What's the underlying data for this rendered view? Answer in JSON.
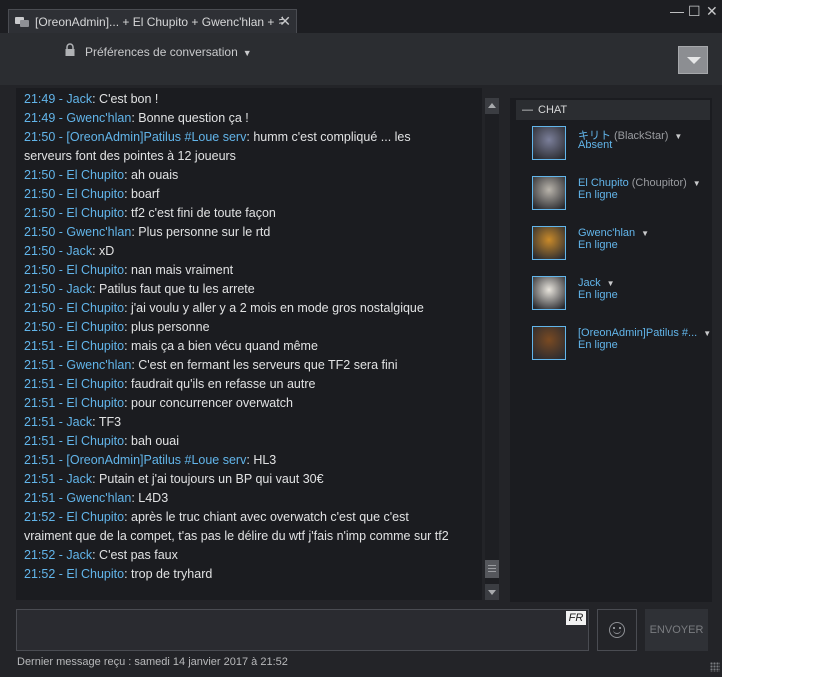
{
  "window": {
    "tab_title": "[OreonAdmin]... + El Chupito + Gwenc'hlan + キ...",
    "tab_close": "✕",
    "minimize": "—",
    "maximize": "☐",
    "close": "✕"
  },
  "toolbar": {
    "prefs_label": "Préférences de conversation",
    "caret": "▼"
  },
  "messages": [
    {
      "who": "21:49 - Jack",
      "text": "C'est bon !"
    },
    {
      "who": "21:49 - Gwenc'hlan",
      "text": "Bonne question ça !"
    },
    {
      "who": "21:50 - [OreonAdmin]Patilus #Loue serv",
      "text": "humm c'est compliqué ... les"
    },
    {
      "who": "",
      "text": "serveurs font des pointes à 12 joueurs"
    },
    {
      "who": "21:50 - El Chupito",
      "text": "ah ouais"
    },
    {
      "who": "21:50 - El Chupito",
      "text": "boarf"
    },
    {
      "who": "21:50 - El Chupito",
      "text": "tf2 c'est fini de toute façon"
    },
    {
      "who": "21:50 - Gwenc'hlan",
      "text": "Plus personne sur le rtd"
    },
    {
      "who": "21:50 - Jack",
      "text": "xD"
    },
    {
      "who": "21:50 - El Chupito",
      "text": "nan mais vraiment"
    },
    {
      "who": "21:50 - Jack",
      "text": "Patilus faut que tu les arrete"
    },
    {
      "who": "21:50 - El Chupito",
      "text": "j'ai voulu y aller y a 2 mois en mode gros nostalgique"
    },
    {
      "who": "21:50 - El Chupito",
      "text": "plus personne"
    },
    {
      "who": "21:51 - El Chupito",
      "text": "mais ça a bien vécu quand même"
    },
    {
      "who": "21:51 - Gwenc'hlan",
      "text": "C'est en fermant les serveurs que TF2 sera fini"
    },
    {
      "who": "21:51 - El Chupito",
      "text": "faudrait qu'ils en refasse un autre"
    },
    {
      "who": "21:51 - El Chupito",
      "text": "pour concurrencer overwatch"
    },
    {
      "who": "21:51 - Jack",
      "text": "TF3"
    },
    {
      "who": "21:51 - El Chupito",
      "text": "bah ouai"
    },
    {
      "who": "21:51 - [OreonAdmin]Patilus #Loue serv",
      "text": "HL3"
    },
    {
      "who": "21:51 - Jack",
      "text": "Putain et j'ai toujours un BP qui vaut 30€"
    },
    {
      "who": "21:51 - Gwenc'hlan",
      "text": "L4D3"
    },
    {
      "who": "21:52 - El Chupito",
      "text": "après le truc chiant avec overwatch c'est que c'est"
    },
    {
      "who": "",
      "text": "vraiment que de la compet, t'as pas le délire du wtf j'fais n'imp comme sur tf2"
    },
    {
      "who": "21:52 - Jack",
      "text": "C'est pas faux"
    },
    {
      "who": "21:52 - El Chupito",
      "text": "trop de tryhard"
    }
  ],
  "sidebar": {
    "header": "CHAT",
    "collapse": "—",
    "members": [
      {
        "name": "キリト",
        "nick": "(BlackStar)",
        "status": "Absent",
        "avatar_color": "#7b7f9a"
      },
      {
        "name": "El Chupito",
        "nick": "(Choupitor)",
        "status": "En ligne",
        "avatar_color": "#b9b4ab"
      },
      {
        "name": "Gwenc'hlan",
        "nick": "",
        "status": "En ligne",
        "avatar_color": "#c98a2a"
      },
      {
        "name": "Jack",
        "nick": "",
        "status": "En ligne",
        "avatar_color": "#e8e4dc"
      },
      {
        "name": "[OreonAdmin]Patilus #...",
        "nick": "",
        "status": "En ligne",
        "avatar_color": "#7a4a22"
      }
    ]
  },
  "composer": {
    "lang": "FR",
    "send_label": "ENVOYER"
  },
  "footer": {
    "last_message": "Dernier message reçu : samedi 14 janvier 2017 à 21:52"
  },
  "colors": {
    "accent": "#62b5ea",
    "background": "#232428",
    "log_background": "#1b1c20"
  }
}
